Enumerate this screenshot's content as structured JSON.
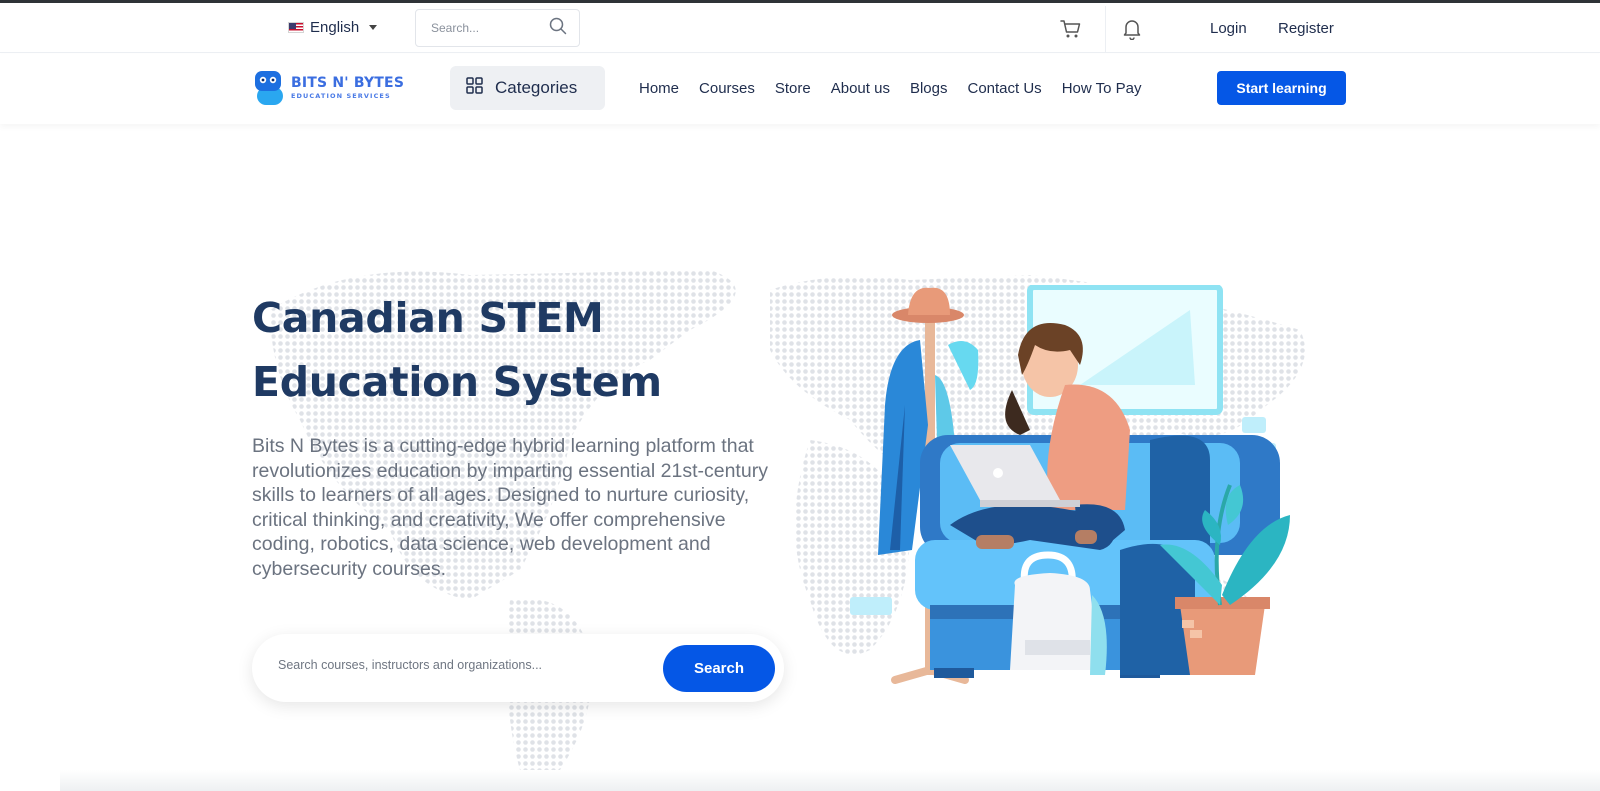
{
  "topbar": {
    "language": "English",
    "search_placeholder": "Search...",
    "login": "Login",
    "register": "Register"
  },
  "nav": {
    "logo_title": "BITS N' BYTES",
    "logo_subtitle": "EDUCATION SERVICES",
    "categories": "Categories",
    "links": [
      "Home",
      "Courses",
      "Store",
      "About us",
      "Blogs",
      "Contact Us",
      "How To Pay"
    ],
    "cta": "Start learning"
  },
  "hero": {
    "title_line1": "Canadian STEM",
    "title_line2": "Education System",
    "description": "Bits N Bytes is a cutting-edge hybrid learning platform that revolutionizes education by imparting essential 21st-century skills to learners of all ages. Designed to nurture curiosity, critical thinking, and creativity, We offer comprehensive coding, robotics, data science, web development and cybersecurity courses.",
    "search_placeholder": "Search courses, instructors and organizations...",
    "search_button": "Search"
  },
  "colors": {
    "primary": "#0557e6",
    "heading": "#1f3a63",
    "text": "#6b7380"
  },
  "icons": [
    "us-flag-icon",
    "chevron-down-icon",
    "search-icon",
    "cart-icon",
    "bell-icon",
    "grid-icon"
  ]
}
